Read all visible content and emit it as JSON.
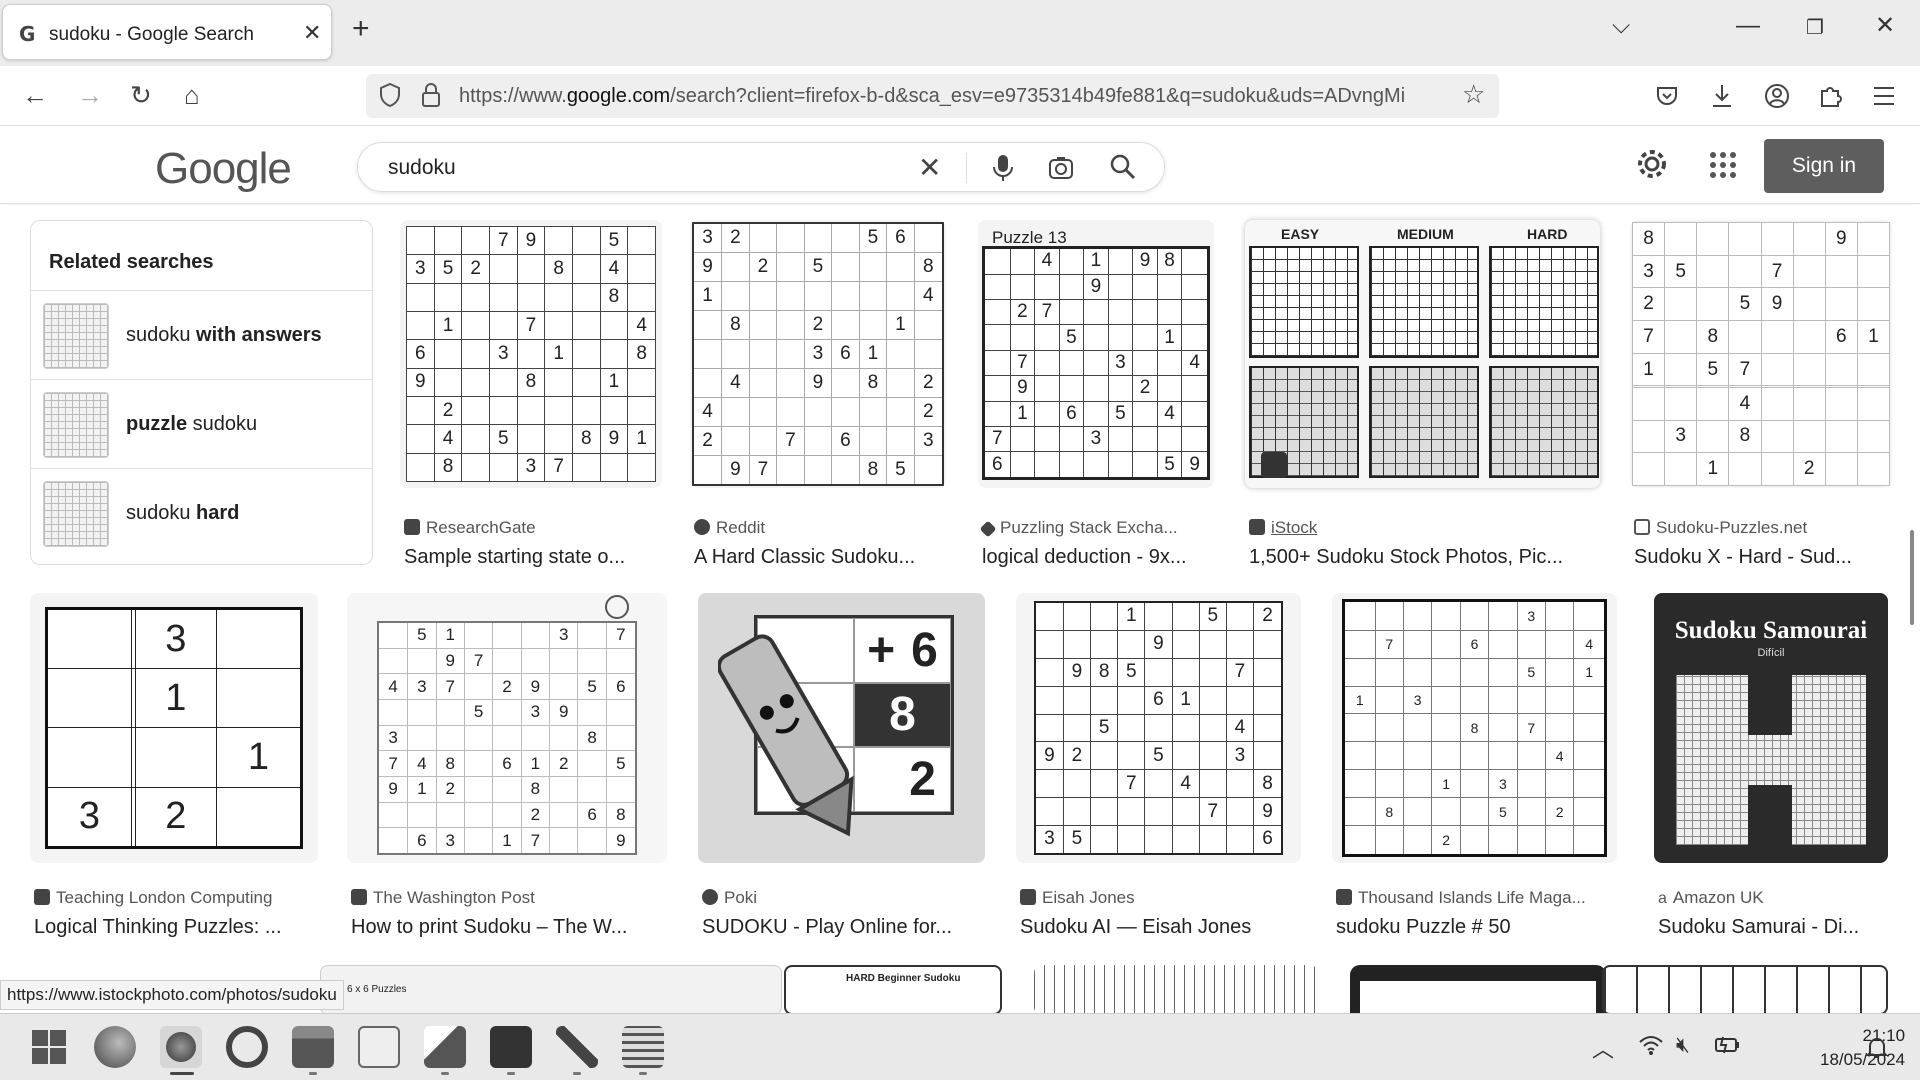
{
  "browser": {
    "tab_title": "sudoku - Google Search",
    "tab_favicon": "G",
    "url_prefix": "https://www.",
    "url_domain": "google.com",
    "url_rest": "/search?client=firefox-b-d&sca_esv=e9735314b49fe881&q=sudoku&uds=ADvngMi",
    "status_url": "https://www.istockphoto.com/photos/sudoku"
  },
  "google": {
    "logo": "Google",
    "query": "sudoku",
    "sign_in": "Sign in"
  },
  "related": {
    "title": "Related searches",
    "items": [
      {
        "bold_first": true,
        "a": "sudoku",
        "b": " with answers"
      },
      {
        "bold_first": true,
        "a": "puzzle",
        "b": " sudoku"
      },
      {
        "bold_first": false,
        "a": "sudoku",
        "b": " hard"
      }
    ]
  },
  "results": [
    {
      "source": "ResearchGate",
      "caption": "Sample starting state o..."
    },
    {
      "source": "Reddit",
      "caption": "A Hard Classic Sudoku..."
    },
    {
      "source": "Puzzling Stack Excha...",
      "caption": "logical deduction - 9x...",
      "header": "Puzzle 13"
    },
    {
      "source": "iStock",
      "caption": "1,500+ Sudoku Stock Photos, Pic...",
      "labels": [
        "EASY",
        "MEDIUM",
        "HARD"
      ]
    },
    {
      "source": "Sudoku-Puzzles.net",
      "caption": "Sudoku X - Hard - Sud..."
    },
    {
      "source": "Teaching London Computing",
      "caption": "Logical Thinking Puzzles: ..."
    },
    {
      "source": "The Washington Post",
      "caption": "How to print Sudoku – The W..."
    },
    {
      "source": "Poki",
      "caption": "SUDOKU - Play Online for..."
    },
    {
      "source": "Eisah Jones",
      "caption": "Sudoku AI — Eisah Jones"
    },
    {
      "source": "Thousand Islands Life Maga...",
      "caption": "sudoku Puzzle # 50"
    },
    {
      "source": "Amazon UK",
      "caption": "Sudoku Samurai - Di...",
      "title": "Sudoku Samourai",
      "sub": "Difícil"
    }
  ],
  "thumb_texts": {
    "poki_numbers": [
      "+",
      "6",
      "8",
      "2"
    ],
    "row3_labels": [
      "6 x 6 Puzzles",
      "HARD Beginner Sudoku"
    ]
  },
  "taskbar": {
    "time": "21:10",
    "date": "18/05/2024"
  },
  "icons": {
    "close": "close-icon",
    "new_tab": "plus-icon",
    "back": "back-arrow-icon",
    "forward": "forward-arrow-icon",
    "reload": "reload-icon",
    "home": "home-icon",
    "star": "bookmark-star-icon",
    "pocket": "pocket-icon",
    "download": "download-icon",
    "account": "account-icon",
    "extensions": "puzzle-extensions-icon",
    "menu": "hamburger-menu-icon"
  }
}
